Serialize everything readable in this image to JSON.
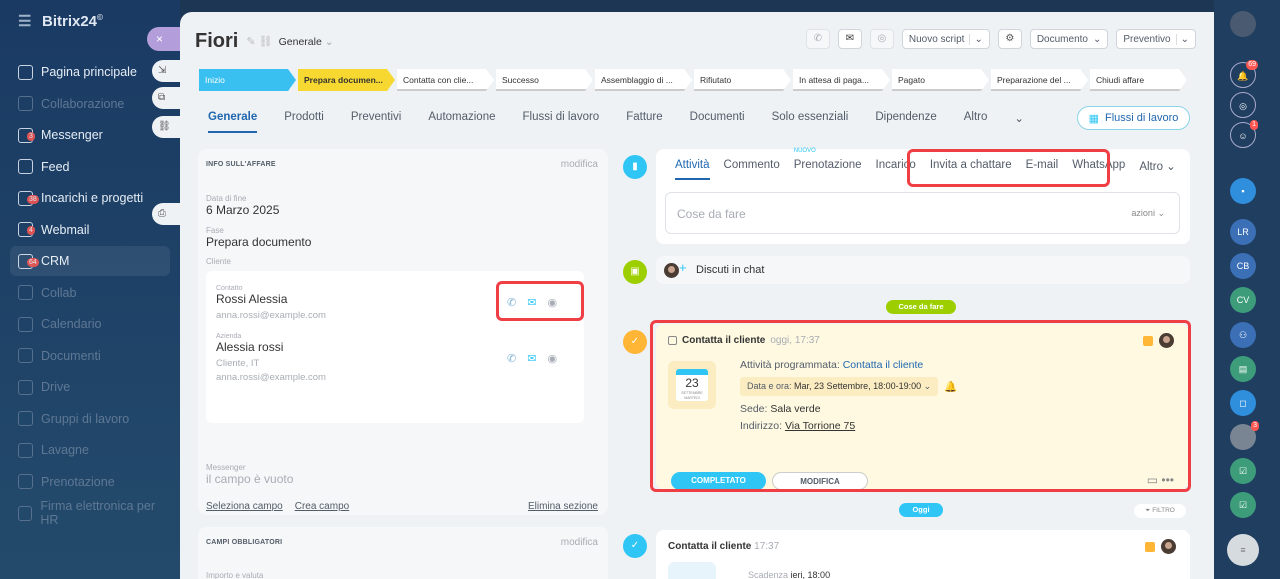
{
  "app": {
    "brand": "Bitrix24",
    "brand_mark": "©"
  },
  "nav": [
    {
      "label": "Pagina principale",
      "icon": "home-icon",
      "badge": ""
    },
    {
      "label": "Collaborazione",
      "icon": "collab-icon",
      "badge": "",
      "dim": true
    },
    {
      "label": "Messenger",
      "icon": "chat-icon",
      "badge": "3"
    },
    {
      "label": "Feed",
      "icon": "feed-icon",
      "badge": ""
    },
    {
      "label": "Incarichi e progetti",
      "icon": "tasks-icon",
      "badge": "38"
    },
    {
      "label": "Webmail",
      "icon": "mail-icon",
      "badge": "4"
    },
    {
      "label": "CRM",
      "icon": "crm-icon",
      "badge": "64"
    },
    {
      "label": "Collab",
      "icon": "collab-circle-icon",
      "badge": "",
      "dim": true
    },
    {
      "label": "Calendario",
      "icon": "calendar-icon",
      "badge": "",
      "dim": true
    },
    {
      "label": "Documenti",
      "icon": "documents-icon",
      "badge": "",
      "dim": true
    },
    {
      "label": "Drive",
      "icon": "drive-icon",
      "badge": "",
      "dim": true
    },
    {
      "label": "Gruppi di lavoro",
      "icon": "groups-icon",
      "badge": "",
      "dim": true
    },
    {
      "label": "Lavagne",
      "icon": "boards-icon",
      "badge": "",
      "dim": true
    },
    {
      "label": "Prenotazione",
      "icon": "booking-icon",
      "badge": "",
      "dim": true
    },
    {
      "label": "Firma elettronica per HR",
      "icon": "sign-icon",
      "badge": "",
      "dim": true
    }
  ],
  "overlay": {
    "close": "×"
  },
  "deal": {
    "title": "Fiori",
    "category": "Generale",
    "buttons": {
      "script": "Nuovo script",
      "document": "Documento",
      "quote": "Preventivo"
    }
  },
  "pipeline": [
    {
      "label": "Inizio",
      "state": "done"
    },
    {
      "label": "Prepara documen...",
      "state": "cur"
    },
    {
      "label": "Contatta con clie...",
      "state": "todo"
    },
    {
      "label": "Successo",
      "state": "todo"
    },
    {
      "label": "Assemblaggio di ...",
      "state": "todo"
    },
    {
      "label": "Rifiutato",
      "state": "todo"
    },
    {
      "label": "In attesa di paga...",
      "state": "todo"
    },
    {
      "label": "Pagato",
      "state": "todo"
    },
    {
      "label": "Preparazione del ...",
      "state": "todo"
    },
    {
      "label": "Chiudi affare",
      "state": "todo"
    }
  ],
  "tabs": [
    "Generale",
    "Prodotti",
    "Preventivi",
    "Automazione",
    "Flussi di lavoro",
    "Fatture",
    "Documenti",
    "Solo essenziali",
    "Dipendenze",
    "Altro"
  ],
  "workflows_btn": "Flussi di lavoro",
  "info": {
    "title": "INFO SULL'AFFARE",
    "edit": "modifica",
    "end_date_label": "Data di fine",
    "end_date": "6 Marzo 2025",
    "stage_label": "Fase",
    "stage": "Prepara documento",
    "client_label": "Cliente",
    "contact_label": "Contatto",
    "contact_name": "Rossi Alessia",
    "contact_email": "anna.rossi@example.com",
    "company_label": "Azienda",
    "company_name": "Alessia rossi",
    "company_sub": "Cliente, IT",
    "company_email": "anna.rossi@example.com",
    "messenger_label": "Messenger",
    "messenger_val": "il campo è vuoto",
    "select_field": "Seleziona campo",
    "create_field": "Crea campo",
    "delete_section": "Elimina sezione"
  },
  "required": {
    "title": "CAMPI OBBLIGATORI",
    "edit": "modifica",
    "amount_label": "Importo e valuta"
  },
  "activity": {
    "tabs": [
      "Attività",
      "Commento",
      "Prenotazione",
      "Incarico",
      "Invita a chattare",
      "E-mail",
      "WhatsApp",
      "Altro"
    ],
    "new_badge": "NUOVO",
    "placeholder": "Cose da fare",
    "actions": "azioni",
    "discuss": "Discuti in chat",
    "todo_pill": "Cose da fare",
    "today_pill": "Oggi",
    "filter": "FILTRO"
  },
  "task": {
    "title": "Contatta il cliente",
    "time": "oggi, 17:37",
    "scheduled_label": "Attività programmata:",
    "scheduled_link": "Contatta il cliente",
    "datetime_label": "Data e ora:",
    "datetime_value": "Mar, 23 Settembre, 18:00-19:00",
    "cal_day": "23",
    "cal_month": "SETTEMBRE",
    "cal_weekday": "MARTEDÌ",
    "place_label": "Sede:",
    "place_value": "Sala verde",
    "address_label": "Indirizzo:",
    "address_value": "Via Torrione 75",
    "done_btn": "COMPLETATO",
    "edit_btn": "MODIFICA"
  },
  "task2": {
    "title": "Contatta il cliente",
    "time": "17:37",
    "deadline_label": "Scadenza",
    "deadline_value": "ieri, 18:00"
  },
  "rightbar": [
    {
      "label": "LR",
      "color": "#3b6fb6"
    },
    {
      "label": "CB",
      "color": "#3b6fb6"
    },
    {
      "label": "CV",
      "color": "#3d9c7a"
    }
  ],
  "colors": {
    "accent": "#2067b0",
    "highlight": "#ef3f45",
    "stage_done": "#39c0f0",
    "stage_current": "#f7d830"
  }
}
